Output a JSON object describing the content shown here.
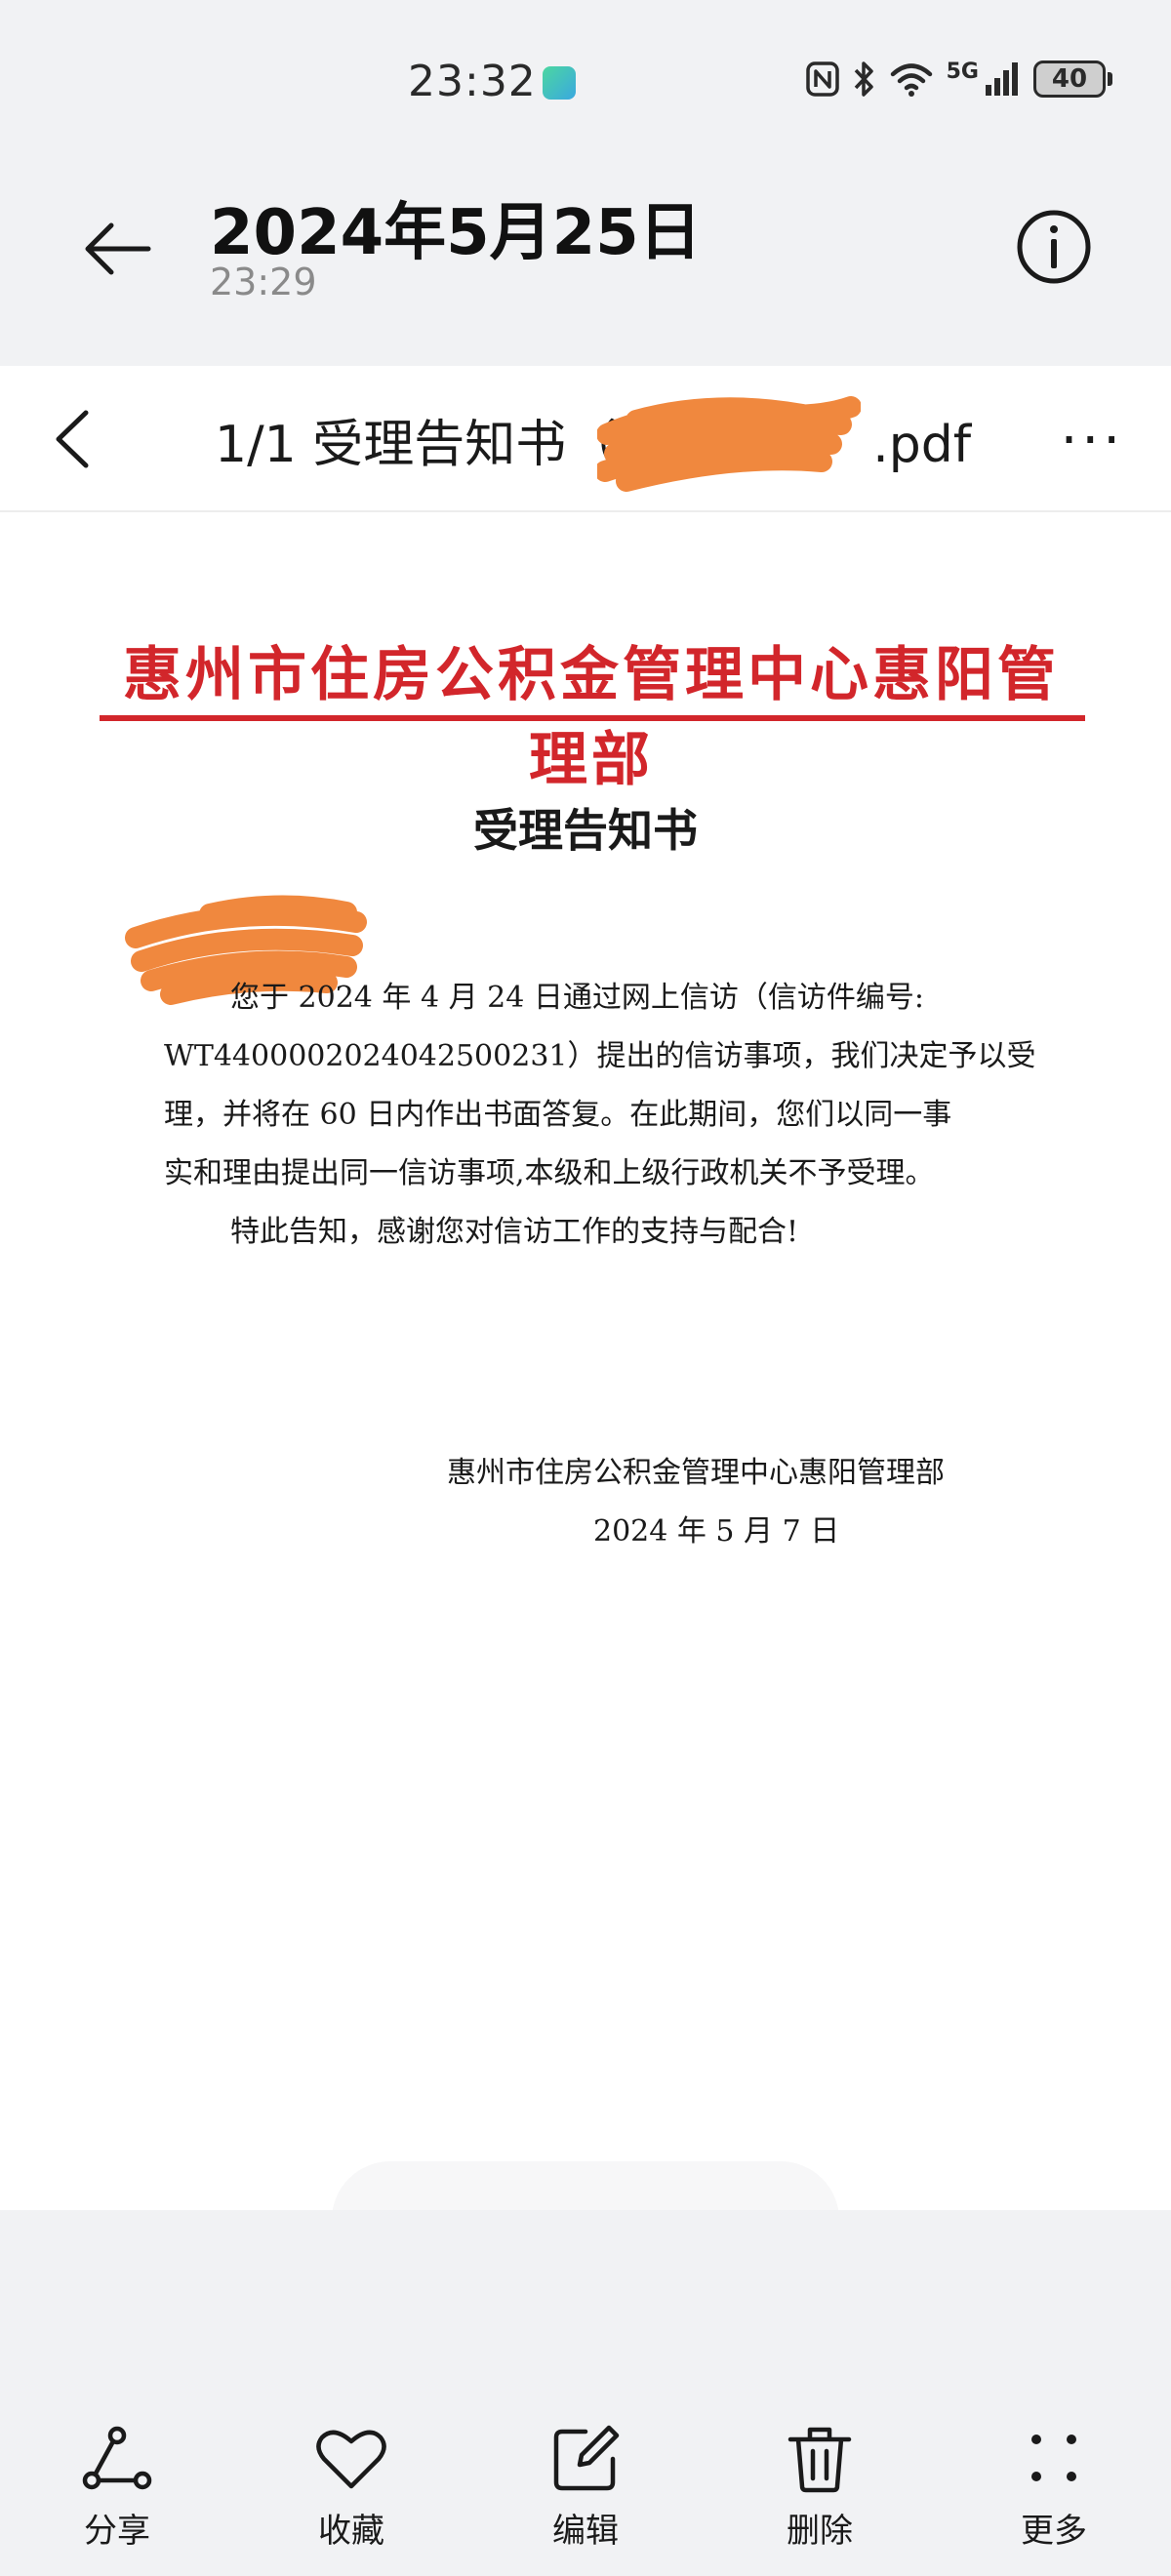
{
  "status_bar": {
    "time": "23:32",
    "network": "5G",
    "battery": "40",
    "icons": [
      "nfc-icon",
      "bluetooth-icon",
      "wifi-icon",
      "signal-icon",
      "battery-icon"
    ]
  },
  "header": {
    "title": "2024年5月25日",
    "subtitle": "23:29",
    "back_icon": "arrow-left-icon",
    "info_icon": "info-icon"
  },
  "viewer": {
    "title": "1/1 受理告知书（",
    "title_suffix": ".pdf",
    "more_label": "···",
    "document": {
      "letterhead": "惠州市住房公积金管理中心惠阳管理部",
      "heading": "受理告知书",
      "body_lines": [
        "您于 2024 年 4 月 24 日通过网上信访（信访件编号:",
        "WT4400002024042500231）提出的信访事项，我们决定予以受",
        "理，并将在 60 日内作出书面答复。在此期间，您们以同一事",
        "实和理由提出同一信访事项,本级和上级行政机关不予受理。"
      ],
      "closing": "特此告知，感谢您对信访工作的支持与配合!",
      "signature_org": "惠州市住房公积金管理中心惠阳管理部",
      "signature_date": "2024 年 5 月 7 日"
    }
  },
  "toolbar": {
    "items": [
      {
        "label": "分享",
        "icon": "share-icon"
      },
      {
        "label": "收藏",
        "icon": "heart-icon"
      },
      {
        "label": "编辑",
        "icon": "edit-icon"
      },
      {
        "label": "删除",
        "icon": "trash-icon"
      },
      {
        "label": "更多",
        "icon": "more-grid-icon"
      }
    ]
  },
  "colors": {
    "letterhead_red": "#d2262b",
    "redaction_orange": "#f0883e",
    "background": "#f1f2f4"
  }
}
